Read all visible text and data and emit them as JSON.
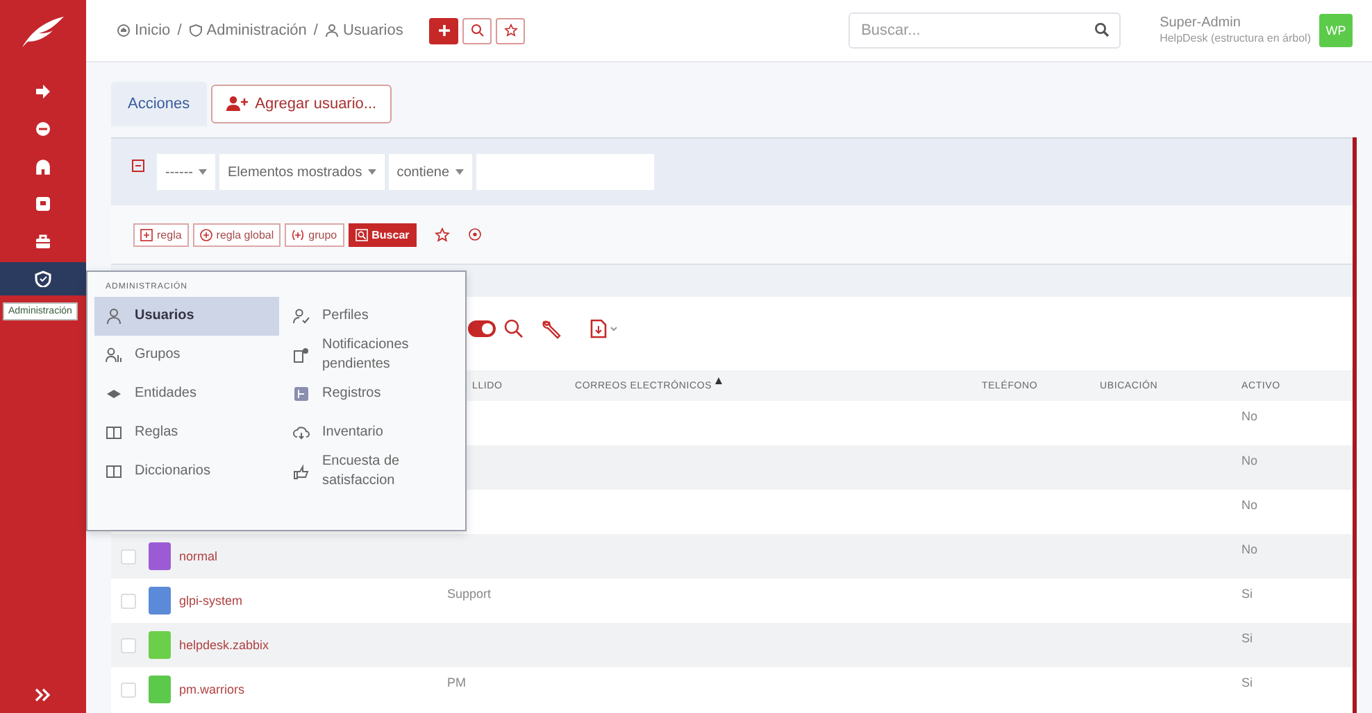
{
  "sidebar": {
    "items": [
      {
        "selected": false
      },
      {
        "selected": false
      },
      {
        "selected": false
      },
      {
        "selected": false
      },
      {
        "selected": false
      },
      {
        "selected": true
      }
    ],
    "tooltip": "Administración"
  },
  "breadcrumb": {
    "separator": "/",
    "items": [
      "Inicio",
      "Administración",
      "Usuarios"
    ]
  },
  "search": {
    "placeholder": "Buscar..."
  },
  "user": {
    "name": "Super-Admin",
    "entity": "HelpDesk (estructura en árbol)",
    "initials": "WP"
  },
  "actions": {
    "tab": "Acciones",
    "add_button": "Agregar usuario..."
  },
  "filter": {
    "field": "------",
    "criterion": "Elementos mostrados",
    "operator": "contiene",
    "buttons": [
      "regla",
      "regla global",
      "grupo",
      "Buscar"
    ]
  },
  "toolbar": {
    "toggle_on": true
  },
  "table": {
    "columns": [
      "LLIDO",
      "CORREOS ELECTRÓNICOS",
      "TELÉFONO",
      "UBICACIÓN",
      "ACTIVO"
    ],
    "rows": [
      {
        "activo": "No"
      },
      {
        "activo": "No"
      },
      {
        "activo": "No"
      },
      {
        "login": "normal",
        "color": "#9b5bd4",
        "checked": false,
        "activo": "No"
      },
      {
        "login": "glpi-system",
        "color": "#5b8ad8",
        "checked": false,
        "apellido": "Support",
        "activo": "Si"
      },
      {
        "login": "helpdesk.zabbix",
        "color": "#6ccf4a",
        "checked": false,
        "activo": "Si"
      },
      {
        "login": "pm.warriors",
        "color": "#5cc94c",
        "checked": false,
        "apellido": "PM",
        "activo": "Si"
      }
    ]
  },
  "admin_menu": {
    "title": "ADMINISTRACIÓN",
    "columns": [
      [
        {
          "label": "Usuarios",
          "selected": true
        },
        {
          "label": "Grupos",
          "selected": false
        },
        {
          "label": "Entidades",
          "selected": false
        },
        {
          "label": "Reglas",
          "selected": false
        },
        {
          "label": "Diccionarios",
          "selected": false
        }
      ],
      [
        {
          "label": "Perfiles",
          "selected": false
        },
        {
          "label": "Notificaciones pendientes",
          "selected": false
        },
        {
          "label": "Registros",
          "selected": false
        },
        {
          "label": "Inventario",
          "selected": false
        },
        {
          "label": "Encuesta de satisfaccion",
          "selected": false
        }
      ]
    ]
  }
}
